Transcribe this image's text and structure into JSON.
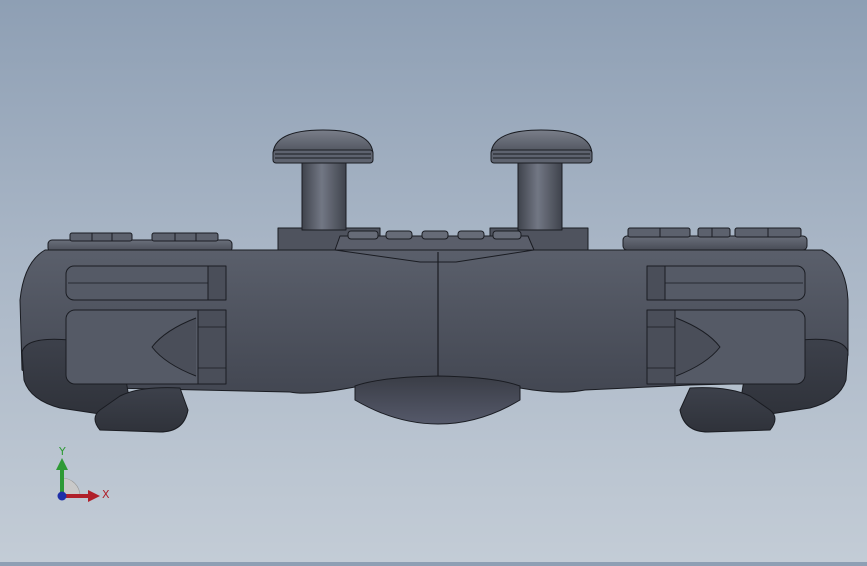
{
  "viewport": {
    "background_top": "#8e9fb4",
    "background_bottom": "#c3ccd6",
    "model_color": "#4d525e",
    "edge_color": "#1a1c22"
  },
  "triad": {
    "x_label": "X",
    "y_label": "Y",
    "x_color": "#b0202a",
    "y_color": "#2e9a35",
    "z_color": "#1e2fa8"
  }
}
